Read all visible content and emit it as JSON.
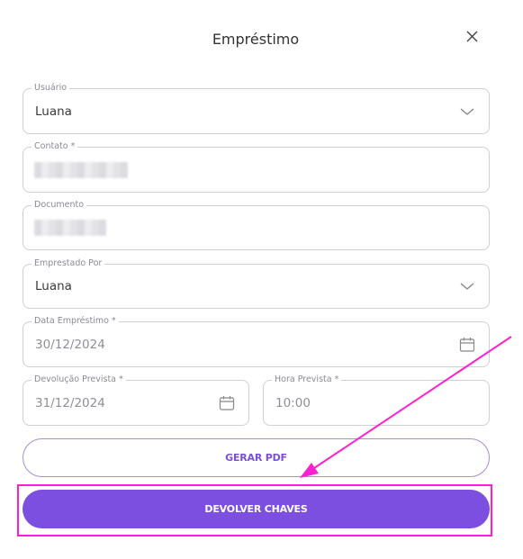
{
  "dialog": {
    "title": "Empréstimo",
    "close_icon": "close-icon"
  },
  "fields": {
    "usuario": {
      "label": "Usuário",
      "value": "Luana"
    },
    "contato": {
      "label": "Contato *",
      "value": ""
    },
    "documento": {
      "label": "Documento",
      "value": ""
    },
    "emprestado_por": {
      "label": "Emprestado Por",
      "value": "Luana"
    },
    "data_emprestimo": {
      "label": "Data Empréstimo *",
      "value": "30/12/2024"
    },
    "devolucao_prevista": {
      "label": "Devolução Prevista *",
      "value": "31/12/2024"
    },
    "hora_prevista": {
      "label": "Hora Prevista *",
      "value": "10:00"
    }
  },
  "buttons": {
    "gerar_pdf": "GERAR PDF",
    "devolver_chaves": "DEVOLVER CHAVES"
  },
  "colors": {
    "accent": "#7d4fe0",
    "annotation": "#ff1fd2",
    "border": "#cfcfd6"
  }
}
